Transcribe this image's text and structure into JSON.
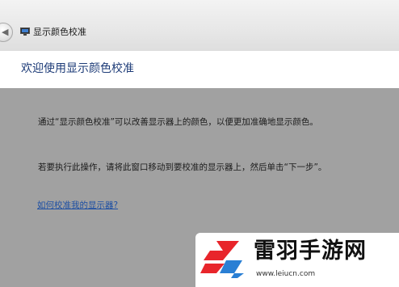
{
  "titlebar": {
    "back_button_icon": "back-arrow-icon",
    "app_icon": "display-calibration-icon",
    "app_title": "显示颜色校准"
  },
  "header": {
    "title": "欢迎使用显示颜色校准"
  },
  "content": {
    "paragraph_1": "通过“显示颜色校准”可以改善显示器上的颜色，以便更加准确地显示颜色。",
    "paragraph_2": "若要执行此操作，请将此窗口移动到要校准的显示器上，然后单击“下一步”。",
    "help_link": "如何校准我的显示器?"
  },
  "watermark": {
    "logo_icon": "leiyu-logo-icon",
    "brand": "雷羽手游网",
    "url": "www.leiucn.com"
  },
  "colors": {
    "title_blue": "#1e3c78",
    "link_blue": "#1d4fa3",
    "content_gray": "#a1a1a1",
    "logo_red": "#e8252b",
    "logo_blue": "#2a7fd4"
  }
}
